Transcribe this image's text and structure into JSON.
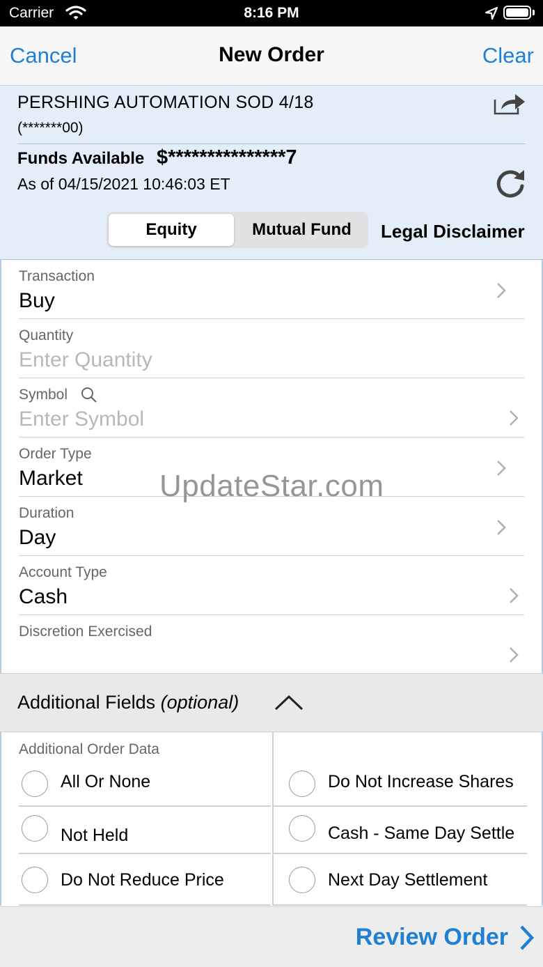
{
  "status_bar": {
    "carrier": "Carrier",
    "time": "8:16 PM"
  },
  "nav": {
    "cancel": "Cancel",
    "title": "New Order",
    "clear": "Clear"
  },
  "account": {
    "name": "PERSHING AUTOMATION SOD 4/18",
    "number": "(*******00)",
    "funds_label": "Funds Available",
    "funds_value": "$***************7",
    "as_of": "As of 04/15/2021 10:46:03 ET"
  },
  "segments": {
    "equity": "Equity",
    "mutual_fund": "Mutual Fund",
    "selected": "Equity"
  },
  "legal_disclaimer": "Legal Disclaimer",
  "fields": {
    "transaction": {
      "label": "Transaction",
      "value": "Buy"
    },
    "quantity": {
      "label": "Quantity",
      "placeholder": "Enter Quantity"
    },
    "symbol": {
      "label": "Symbol",
      "placeholder": "Enter Symbol"
    },
    "order_type": {
      "label": "Order Type",
      "value": "Market"
    },
    "duration": {
      "label": "Duration",
      "value": "Day"
    },
    "account_type": {
      "label": "Account Type",
      "value": "Cash"
    },
    "discretion": {
      "label": "Discretion Exercised",
      "value": ""
    }
  },
  "additional": {
    "title": "Additional Fields",
    "optional": "(optional)",
    "subheader": "Additional Order Data",
    "options": {
      "all_or_none": "All Or None",
      "do_not_increase_shares": "Do Not Increase Shares",
      "not_held": "Not Held",
      "cash_same_day": "Cash - Same Day Settle",
      "do_not_reduce_price": "Do Not Reduce Price",
      "next_day_settlement": "Next Day Settlement"
    }
  },
  "footer": {
    "review_order": "Review Order"
  },
  "watermark": "UpdateStar.com",
  "colors": {
    "accent": "#1f7fd3",
    "account_bg": "#e3eef9",
    "placeholder": "#b8b8b8"
  }
}
